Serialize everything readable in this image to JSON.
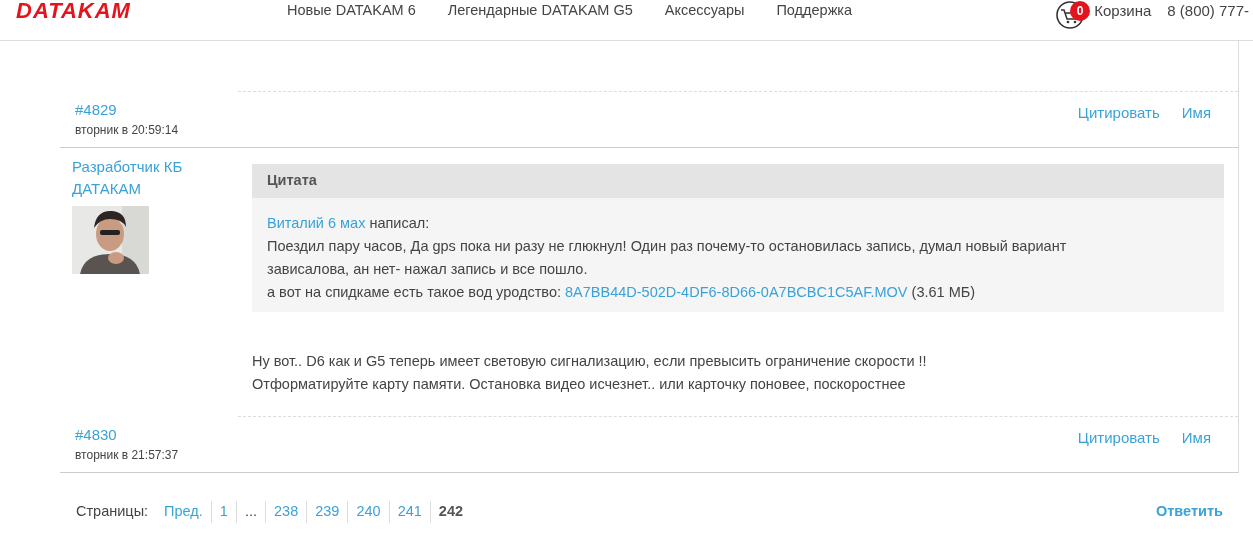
{
  "header": {
    "logo": "DATAKAM",
    "nav": [
      "Новые DATAKAM 6",
      "Легендарные DATAKAM G5",
      "Аксессуары",
      "Поддержка"
    ],
    "cart": {
      "badge": "0",
      "label": "Корзина"
    },
    "phone": "8 (800) 777-"
  },
  "posts": [
    {
      "number": "#4829",
      "date": "вторник в 20:59:14",
      "actions": [
        "Цитировать",
        "Имя"
      ]
    },
    {
      "author": "Разработчик КБ ДАТАКАМ",
      "quote": {
        "title": "Цитата",
        "who": "Виталий 6 мах",
        "wrote": "написал:",
        "text": "Поездил пару часов, Да gps пока ни разу не глюкнул! Один раз почему-то остановилась запись, думал новый вариант зависалова, ан нет- нажал запись и все пошло.",
        "attachment_prefix": "а вот на спидкаме есть такое вод уродство:",
        "attachment": "8A7BB44D-502D-4DF6-8D66-0A7BCBC1C5AF.MOV",
        "attachment_size": "(3.61 МБ)"
      },
      "body": [
        "Ну вот.. D6 как и G5 теперь имеет световую сигнализацию, если превысить ограничение скорости !!",
        "Отформатируйте карту памяти. Остановка видео исчезнет.. или карточку поновее, поскоростнее"
      ],
      "number": "#4830",
      "date": "вторник в 21:57:37",
      "actions": [
        "Цитировать",
        "Имя"
      ]
    }
  ],
  "pagination": {
    "label": "Страницы:",
    "items": [
      {
        "label": "Пред.",
        "kind": "link",
        "selected": false
      },
      {
        "label": "1",
        "kind": "link",
        "selected": false
      },
      {
        "label": "...",
        "kind": "ellipsis"
      },
      {
        "label": "238",
        "kind": "link",
        "selected": false
      },
      {
        "label": "239",
        "kind": "link",
        "selected": false
      },
      {
        "label": "240",
        "kind": "link",
        "selected": false
      },
      {
        "label": "241",
        "kind": "link",
        "selected": false
      },
      {
        "label": "242",
        "kind": "link",
        "selected": true
      }
    ],
    "reply": "Ответить"
  }
}
